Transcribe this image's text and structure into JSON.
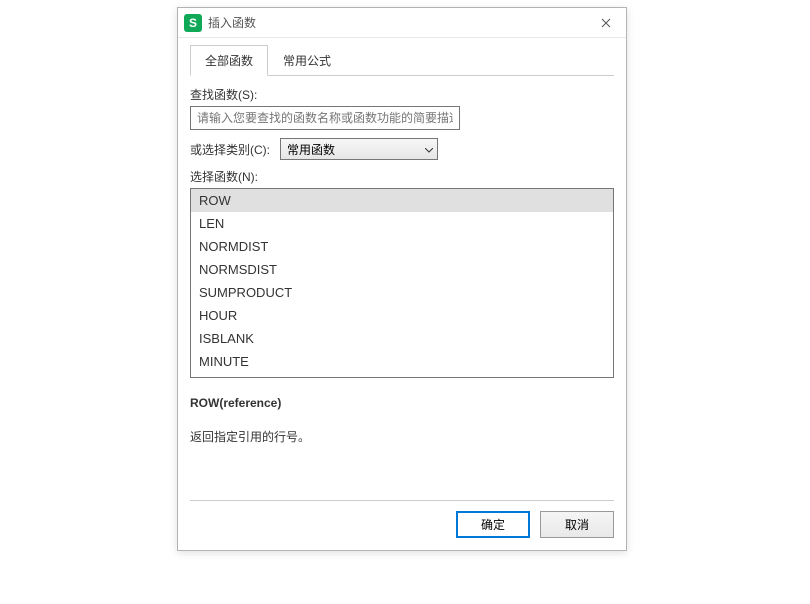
{
  "titlebar": {
    "icon_letter": "S",
    "title": "插入函数"
  },
  "tabs": {
    "all_functions": "全部函数",
    "common_formulas": "常用公式"
  },
  "search": {
    "label": "查找函数(S):",
    "placeholder": "请输入您要查找的函数名称或函数功能的简要描述..."
  },
  "category": {
    "label": "或选择类别(C):",
    "selected": "常用函数"
  },
  "function_list": {
    "label": "选择函数(N):",
    "items": [
      "ROW",
      "LEN",
      "NORMDIST",
      "NORMSDIST",
      "SUMPRODUCT",
      "HOUR",
      "ISBLANK",
      "MINUTE"
    ],
    "selected_index": 0
  },
  "detail": {
    "signature": "ROW(reference)",
    "description": "返回指定引用的行号。"
  },
  "buttons": {
    "ok": "确定",
    "cancel": "取消"
  }
}
